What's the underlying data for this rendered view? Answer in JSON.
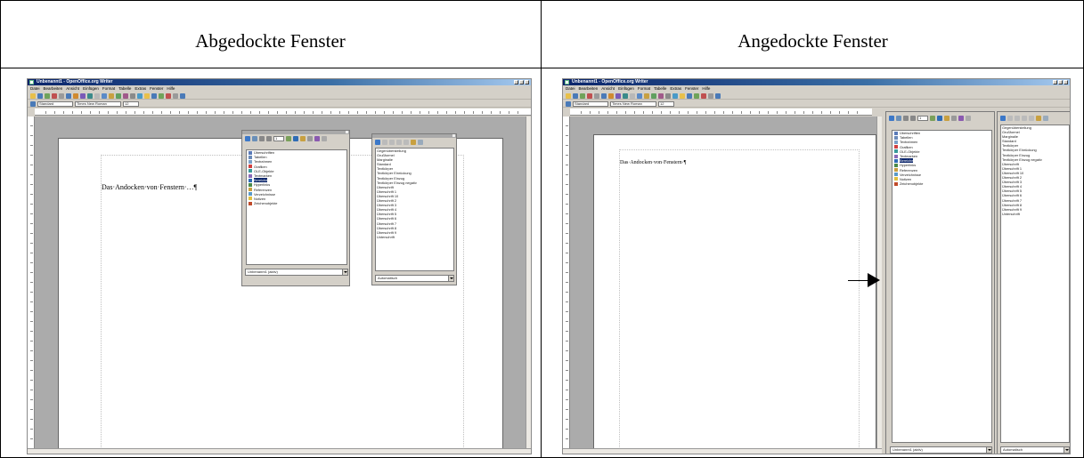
{
  "headers": {
    "left": "Abgedockte Fenster",
    "right": "Angedockte Fenster"
  },
  "window": {
    "title": "Unbenannt1 - OpenOffice.org Writer",
    "menu": [
      "Datei",
      "Bearbeiten",
      "Ansicht",
      "Einfügen",
      "Format",
      "Tabelle",
      "Extras",
      "Fenster",
      "Hilfe"
    ],
    "style_value": "Standard",
    "font_value": "Times New Roman",
    "size_value": "12"
  },
  "left": {
    "doc_text": "Das·Andocken·von·Fenstern·…¶"
  },
  "right": {
    "doc_text": "Das·Andocken·von·Fenstern·¶"
  },
  "navigator": {
    "spin_value": "1",
    "items": [
      "Überschriften",
      "Tabellen",
      "Textrahmen",
      "Grafiken",
      "OLE-Objekte",
      "Textmarken",
      "Bereiche",
      "Hyperlinks",
      "Referenzen",
      "Verzeichnisse",
      "Notizen",
      "Zeichenobjekte"
    ],
    "selected_index": 6,
    "document_value": "Unbenannt1 (aktiv)"
  },
  "stylist": {
    "items": [
      "Gegenüberstellung",
      "Grußformel",
      "Marginalie",
      "Standard",
      "Textkörper",
      "Textkörper Einrückung",
      "Textkörper Einzug",
      "Textkörper Einzug negativ",
      "Überschrift",
      "Überschrift 1",
      "Überschrift 10",
      "Überschrift 2",
      "Überschrift 3",
      "Überschrift 4",
      "Überschrift 5",
      "Überschrift 6",
      "Überschrift 7",
      "Überschrift 8",
      "Überschrift 9",
      "Unterschrift"
    ],
    "filter_value": "Automatisch"
  },
  "colors": {
    "selection": "#0a246a",
    "titlebar": "#0a246a",
    "workspace": "#ababab"
  }
}
